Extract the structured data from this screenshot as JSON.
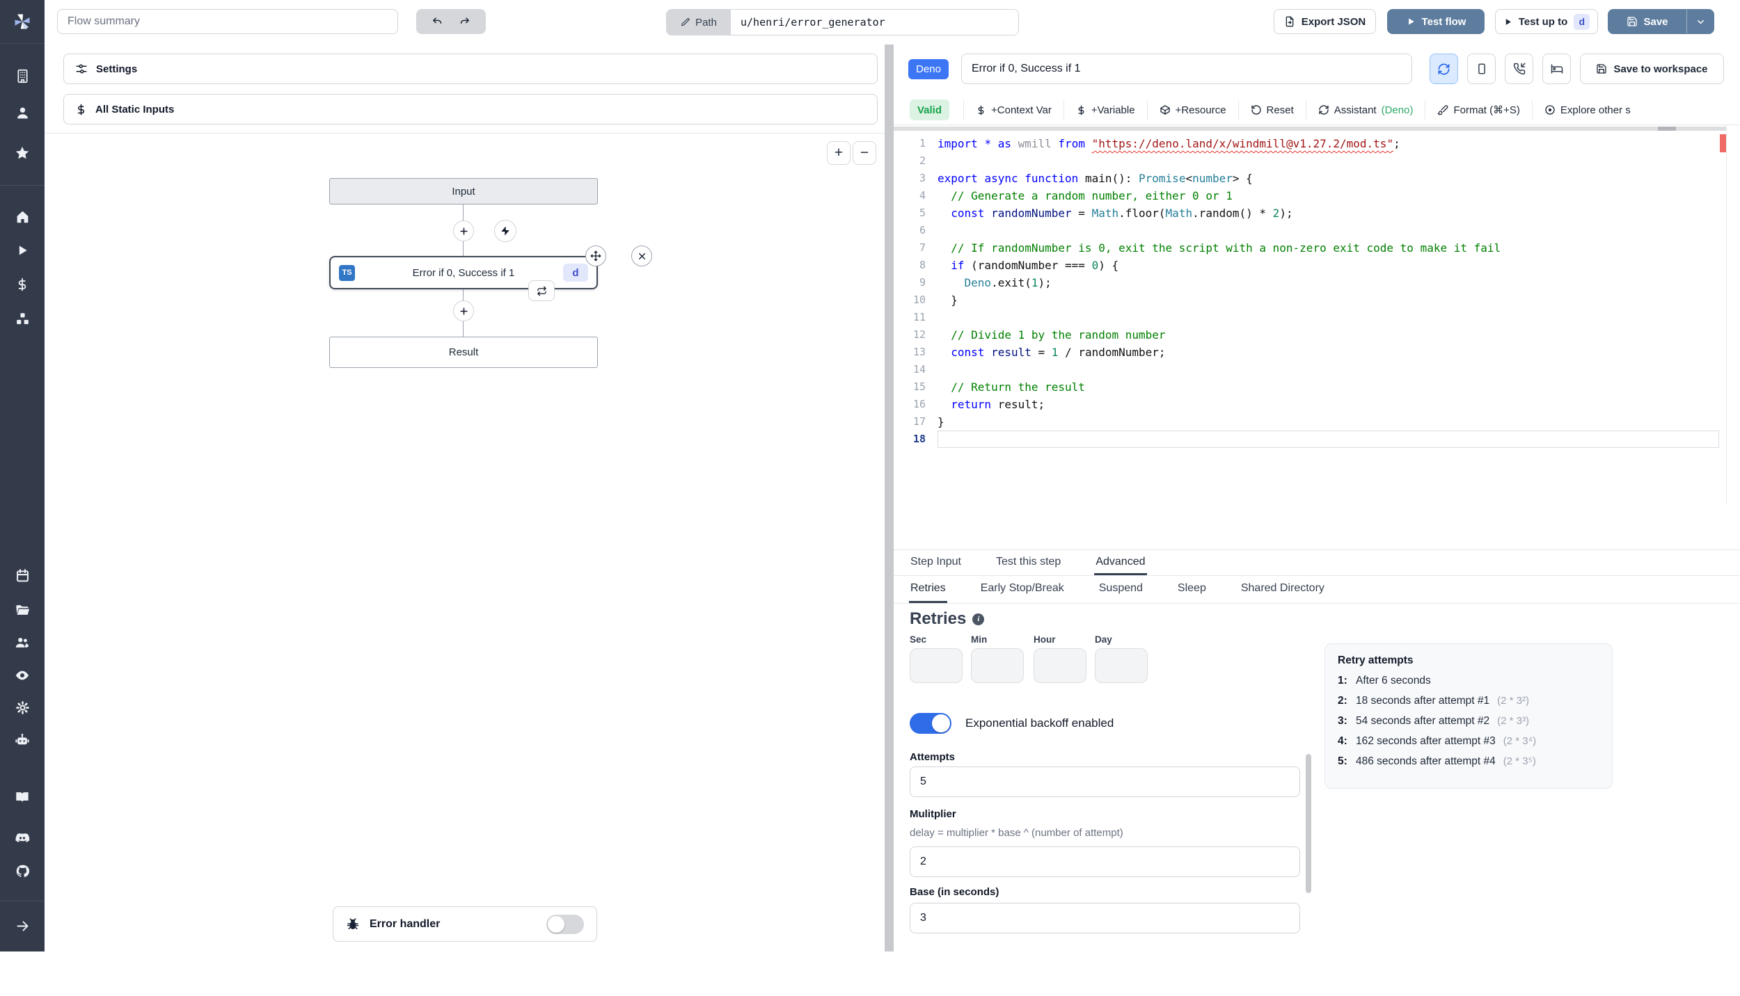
{
  "topbar": {
    "flow_summary_placeholder": "Flow summary",
    "path_label": "Path",
    "path_value": "u/henri/error_generator",
    "export_json_label": "Export JSON",
    "test_flow_label": "Test flow",
    "test_up_to_label": "Test up to",
    "test_up_to_key": "d",
    "save_label": "Save"
  },
  "left_panel": {
    "settings_label": "Settings",
    "static_inputs_label": "All Static Inputs",
    "zoom_in_label": "+",
    "zoom_out_label": "−",
    "flow": {
      "input_node_label": "Input",
      "step_node": {
        "language_badge": "TS",
        "label": "Error if 0, Success if 1",
        "key_badge": "d"
      },
      "result_node_label": "Result",
      "error_handler_label": "Error handler"
    }
  },
  "script_header": {
    "language_badge": "Deno",
    "title_value": "Error if 0, Success if 1",
    "save_to_workspace_label": "Save to workspace"
  },
  "toolbar": {
    "valid_badge": "Valid",
    "context_var": "+Context Var",
    "variable": "+Variable",
    "resource": "+Resource",
    "reset": "Reset",
    "assistant": "Assistant",
    "assistant_lang": "(Deno)",
    "format": "Format (⌘+S)",
    "explore": "Explore other s"
  },
  "code": {
    "lines": [
      [
        [
          "k",
          "import"
        ],
        [
          "d",
          " "
        ],
        [
          "k",
          "*"
        ],
        [
          "d",
          " "
        ],
        [
          "k",
          "as"
        ],
        [
          "f",
          " wmill "
        ],
        [
          "k",
          "from"
        ],
        [
          "d",
          " "
        ],
        [
          "e",
          "\"https://deno.land/x/windmill@v1.27.2/mod.ts\""
        ],
        [
          "d",
          ";"
        ]
      ],
      [],
      [
        [
          "k",
          "export"
        ],
        [
          "d",
          " "
        ],
        [
          "k",
          "async"
        ],
        [
          "d",
          " "
        ],
        [
          "k",
          "function"
        ],
        [
          "d",
          " main(): "
        ],
        [
          "t",
          "Promise"
        ],
        [
          "d",
          "<"
        ],
        [
          "t",
          "number"
        ],
        [
          "d",
          "> {"
        ]
      ],
      [
        [
          "c",
          "  // Generate a random number, either 0 or 1"
        ]
      ],
      [
        [
          "d",
          "  "
        ],
        [
          "k",
          "const"
        ],
        [
          "v",
          " randomNumber"
        ],
        [
          "d",
          " = "
        ],
        [
          "t",
          "Math"
        ],
        [
          "d",
          ".floor("
        ],
        [
          "t",
          "Math"
        ],
        [
          "d",
          ".random() * "
        ],
        [
          "n",
          "2"
        ],
        [
          "d",
          ");"
        ]
      ],
      [],
      [
        [
          "c",
          "  // If randomNumber is 0, exit the script with a non-zero exit code to make it fail"
        ]
      ],
      [
        [
          "d",
          "  "
        ],
        [
          "k",
          "if"
        ],
        [
          "d",
          " (randomNumber === "
        ],
        [
          "n",
          "0"
        ],
        [
          "d",
          ") {"
        ]
      ],
      [
        [
          "d",
          "    "
        ],
        [
          "t",
          "Deno"
        ],
        [
          "d",
          ".exit("
        ],
        [
          "n",
          "1"
        ],
        [
          "d",
          ");"
        ]
      ],
      [
        [
          "d",
          "  }"
        ]
      ],
      [],
      [
        [
          "c",
          "  // Divide 1 by the random number"
        ]
      ],
      [
        [
          "d",
          "  "
        ],
        [
          "k",
          "const"
        ],
        [
          "v",
          " result"
        ],
        [
          "d",
          " = "
        ],
        [
          "n",
          "1"
        ],
        [
          "d",
          " / randomNumber;"
        ]
      ],
      [],
      [
        [
          "c",
          "  // Return the result"
        ]
      ],
      [
        [
          "d",
          "  "
        ],
        [
          "k",
          "return"
        ],
        [
          "d",
          " result;"
        ]
      ],
      [
        [
          "d",
          "}"
        ]
      ],
      []
    ],
    "current_line": 18
  },
  "step_tabs": {
    "step_input": "Step Input",
    "test_this_step": "Test this step",
    "advanced": "Advanced"
  },
  "advanced_tabs": {
    "retries": "Retries",
    "early_stop": "Early Stop/Break",
    "suspend": "Suspend",
    "sleep": "Sleep",
    "shared_directory": "Shared Directory"
  },
  "retries": {
    "heading": "Retries",
    "time_units": [
      "Sec",
      "Min",
      "Hour",
      "Day"
    ],
    "backoff_toggle_label": "Exponential backoff enabled",
    "attempts_label": "Attempts",
    "attempts_value": "5",
    "multiplier_label": "Mulitplier",
    "multiplier_help": "delay = multiplier * base ^ (number of attempt)",
    "multiplier_value": "2",
    "base_label": "Base (in seconds)",
    "base_value": "3"
  },
  "retry_preview": {
    "title": "Retry attempts",
    "items": [
      {
        "index": "1:",
        "text": "After 6 seconds",
        "formula": ""
      },
      {
        "index": "2:",
        "text": "18 seconds after attempt #1",
        "formula": "(2 * 3²)"
      },
      {
        "index": "3:",
        "text": "54 seconds after attempt #2",
        "formula": "(2 * 3³)"
      },
      {
        "index": "4:",
        "text": "162 seconds after attempt #3",
        "formula": "(2 * 3⁴)"
      },
      {
        "index": "5:",
        "text": "486 seconds after attempt #4",
        "formula": "(2 * 3⁵)"
      }
    ]
  },
  "sidebar_icons": [
    "windmill-logo",
    "building",
    "user",
    "star",
    "home",
    "play",
    "dollar",
    "boxes",
    "calendar",
    "folder-open",
    "users",
    "eye",
    "gear",
    "robot",
    "book",
    "discord",
    "github",
    "collapse-arrow"
  ],
  "colors": {
    "sidebar_bg": "#333a49",
    "primary_button": "#5e7d9e",
    "deno_badge": "#3c76f5",
    "ts_badge": "#3177c6",
    "valid_bg": "#dcf3e4",
    "valid_text": "#16a34a",
    "assistant_green": "#2fa868",
    "toggle_on": "#2f6ce8",
    "key_badge_bg": "#e3e7fb",
    "key_badge_text": "#3b4fc4",
    "error_marker": "#ef6a66"
  }
}
